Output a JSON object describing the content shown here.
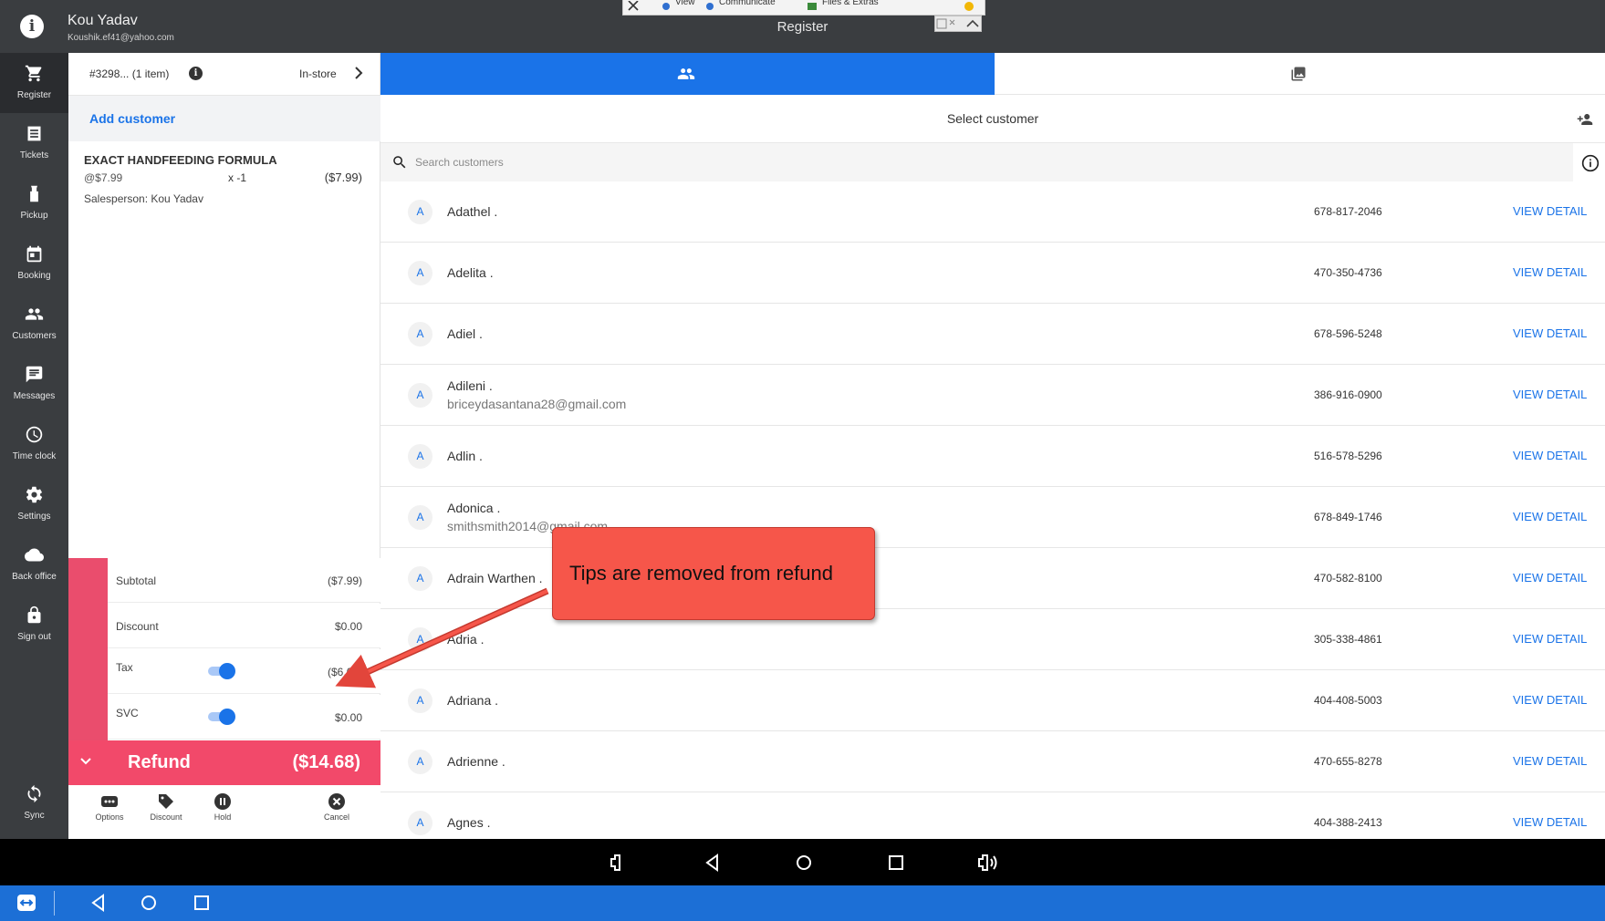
{
  "header": {
    "user_name": "Kou Yadav",
    "user_email": "Koushik.ef41@yahoo.com",
    "page_title": "Register"
  },
  "remote_toolbar": {
    "items": [
      "View",
      "Communicate",
      "Files & Extras"
    ]
  },
  "nav": {
    "items": [
      {
        "label": "Register",
        "icon": "cart-icon",
        "active": true
      },
      {
        "label": "Tickets",
        "icon": "tickets-icon"
      },
      {
        "label": "Pickup",
        "icon": "pickup-icon"
      },
      {
        "label": "Booking",
        "icon": "calendar-icon"
      },
      {
        "label": "Customers",
        "icon": "people-icon"
      },
      {
        "label": "Messages",
        "icon": "message-icon"
      },
      {
        "label": "Time clock",
        "icon": "clock-icon"
      },
      {
        "label": "Settings",
        "icon": "gear-icon"
      },
      {
        "label": "Back office",
        "icon": "cloud-icon"
      },
      {
        "label": "Sign out",
        "icon": "lock-icon"
      }
    ],
    "sync_label": "Sync"
  },
  "cart": {
    "order_number": "#3298... (1 item)",
    "channel": "In-store",
    "add_customer": "Add customer",
    "item": {
      "name": "EXACT HANDFEEDING FORMULA",
      "unit_price": "@$7.99",
      "qty": "x  -1",
      "total": "($7.99)",
      "salesperson": "Salesperson: Kou Yadav"
    },
    "totals": {
      "subtotal_label": "Subtotal",
      "subtotal": "($7.99)",
      "discount_label": "Discount",
      "discount": "$0.00",
      "tax_label": "Tax",
      "tax": "($6.69)",
      "tax_enabled": true,
      "svc_label": "SVC",
      "svc": "$0.00",
      "svc_enabled": true
    },
    "refund_label": "Refund",
    "refund_total": "($14.68)",
    "actions": [
      "Options",
      "Discount",
      "Hold",
      "Cancel"
    ]
  },
  "customers": {
    "header": "Select customer",
    "search_placeholder": "Search customers",
    "view_label": "VIEW DETAIL",
    "list": [
      {
        "initial": "A",
        "name": "Adathel .",
        "email": "",
        "phone": "678-817-2046"
      },
      {
        "initial": "A",
        "name": "Adelita .",
        "email": "",
        "phone": "470-350-4736"
      },
      {
        "initial": "A",
        "name": "Adiel .",
        "email": "",
        "phone": "678-596-5248"
      },
      {
        "initial": "A",
        "name": "Adileni .",
        "email": "briceydasantana28@gmail.com",
        "phone": "386-916-0900"
      },
      {
        "initial": "A",
        "name": "Adlin .",
        "email": "",
        "phone": "516-578-5296"
      },
      {
        "initial": "A",
        "name": "Adonica .",
        "email": "smithsmith2014@gmail.com",
        "phone": "678-849-1746"
      },
      {
        "initial": "A",
        "name": "Adrain Warthen .",
        "email": "",
        "phone": "470-582-8100"
      },
      {
        "initial": "A",
        "name": "Adria .",
        "email": "",
        "phone": "305-338-4861"
      },
      {
        "initial": "A",
        "name": "Adriana .",
        "email": "",
        "phone": "404-408-5003"
      },
      {
        "initial": "A",
        "name": "Adrienne .",
        "email": "",
        "phone": "470-655-8278"
      },
      {
        "initial": "A",
        "name": "Agnes .",
        "email": "",
        "phone": "404-388-2413"
      }
    ]
  },
  "callout": {
    "text": "Tips are removed from refund",
    "color": "#f6564a"
  },
  "colors": {
    "accent": "#1a73e8",
    "refund": "#f2496a",
    "nav_bg": "#3a3d40"
  }
}
